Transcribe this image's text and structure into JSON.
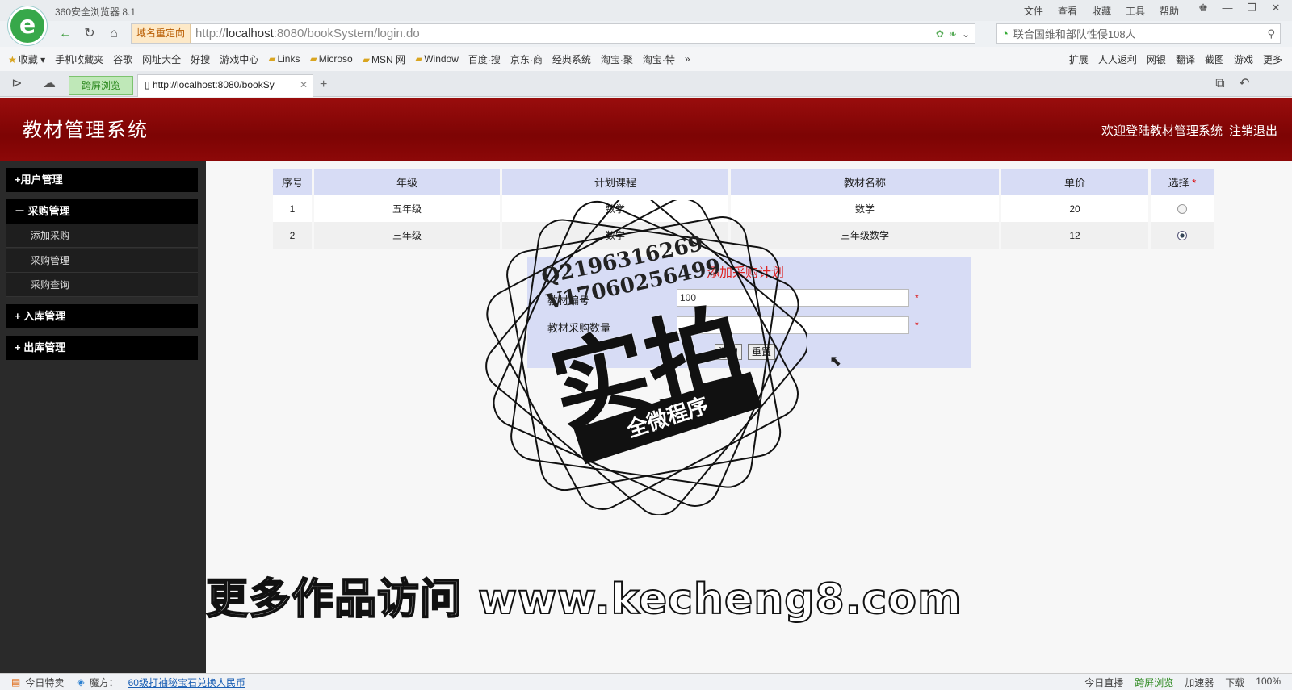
{
  "browser": {
    "app_title": "360安全浏览器 8.1",
    "menus": [
      "文件",
      "查看",
      "收藏",
      "工具",
      "帮助"
    ],
    "redirect_label": "域名重定向",
    "url_prefix": "http://",
    "url_host": "localhost",
    "url_rest": ":8080/bookSystem/login.do",
    "search_text": "联合国维和部队性侵108人",
    "bookmarks": [
      "收藏",
      "手机收藏夹",
      "谷歌",
      "网址大全",
      "好搜",
      "游戏中心",
      "Links",
      "Microso",
      "MSN 网",
      "Window",
      "百度·搜",
      "京东·商",
      "经典系统",
      "淘宝·聚",
      "淘宝·特"
    ],
    "bookmarks_right": [
      "扩展",
      "人人返利",
      "网银",
      "翻译",
      "截图",
      "游戏",
      "更多"
    ],
    "tabs": [
      {
        "label": "跨屏浏览"
      },
      {
        "label": "http://localhost:8080/bookSy"
      }
    ]
  },
  "header": {
    "system_title": "教材管理系统",
    "welcome": "欢迎登陆教材管理系统",
    "logout": "注销退出"
  },
  "sidebar": {
    "groups": [
      {
        "label": "+用户管理"
      },
      {
        "label": "－ 采购管理",
        "items": [
          "添加采购",
          "采购管理",
          "采购查询"
        ]
      },
      {
        "label": "+ 入库管理"
      },
      {
        "label": "+ 出库管理"
      }
    ]
  },
  "table": {
    "headers": [
      "序号",
      "年级",
      "计划课程",
      "教材名称",
      "单价",
      "选择"
    ],
    "rows": [
      {
        "no": "1",
        "grade": "五年级",
        "course": "数学",
        "book": "数学",
        "price": "20",
        "selected": false
      },
      {
        "no": "2",
        "grade": "三年级",
        "course": "数学",
        "book": "三年级数学",
        "price": "12",
        "selected": true
      }
    ]
  },
  "form": {
    "title": "添加采购计划",
    "field1_label": "教材编号",
    "field1_value": "100",
    "field2_label": "教材采购数量",
    "field2_value": "",
    "add_button": "添加",
    "reset_button": "重置"
  },
  "watermark": {
    "qq": "Q2196316269",
    "vx": "V17060256499",
    "stamp": "实拍",
    "banner": "全微程序",
    "site": "更多作品访问 www.kecheng8.com"
  },
  "statusbar": {
    "items": [
      "今日特卖",
      "魔方："
    ],
    "link": "60级打袖秘宝石兑换人民币",
    "right": [
      "今日直播",
      "跨屏浏览",
      "加速器",
      "下载",
      "100%"
    ]
  },
  "colors": {
    "header_red": "#8d0808",
    "table_header": "#d7dcf5",
    "sidebar": "#2a2a2a"
  }
}
